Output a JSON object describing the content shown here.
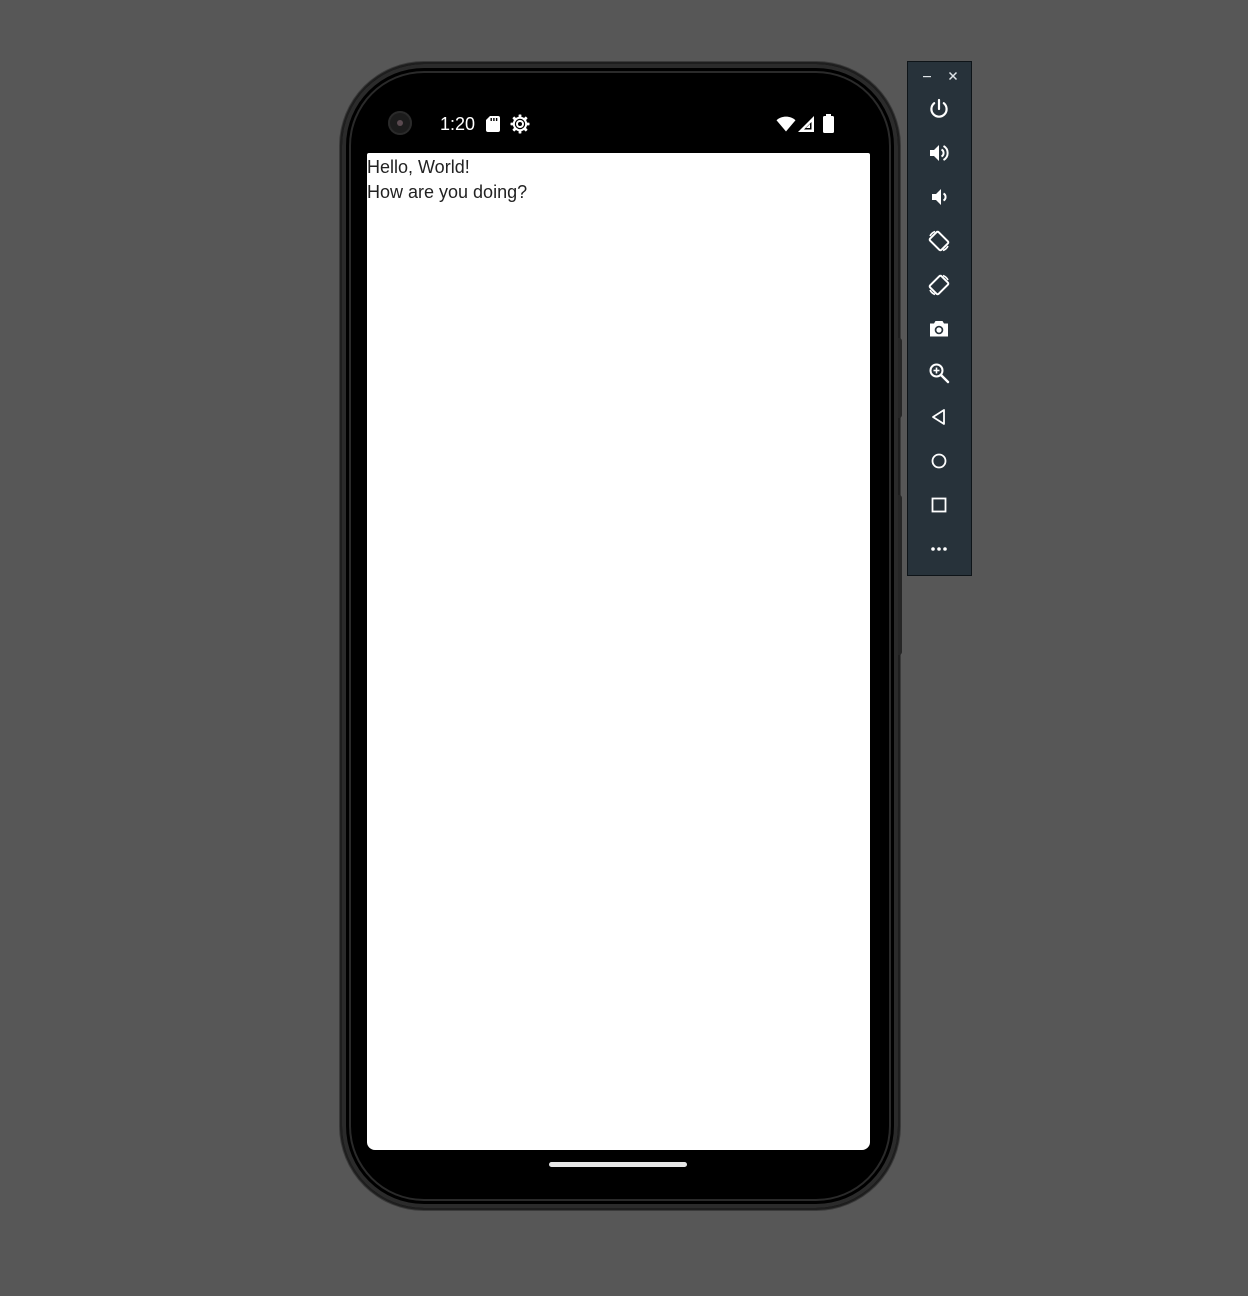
{
  "status_bar": {
    "time": "1:20",
    "icons": [
      "camera-cutout",
      "sd-card-icon",
      "settings-gear-icon",
      "wifi-icon",
      "cell-signal-icon",
      "battery-icon"
    ]
  },
  "app": {
    "lines": [
      "Hello, World!",
      "How are you doing?"
    ]
  },
  "toolbar": {
    "window_controls": [
      "minimize-icon",
      "close-icon"
    ],
    "buttons": [
      "power-icon",
      "volume-up-icon",
      "volume-down-icon",
      "rotate-left-icon",
      "rotate-right-icon",
      "camera-icon",
      "zoom-icon",
      "back-icon",
      "home-icon",
      "overview-icon",
      "more-icon"
    ]
  },
  "colors": {
    "desktop": "#575757",
    "toolbar_bg": "#27323a",
    "screen_bg": "#ffffff",
    "text": "#222222",
    "icon_white": "#ffffff"
  }
}
